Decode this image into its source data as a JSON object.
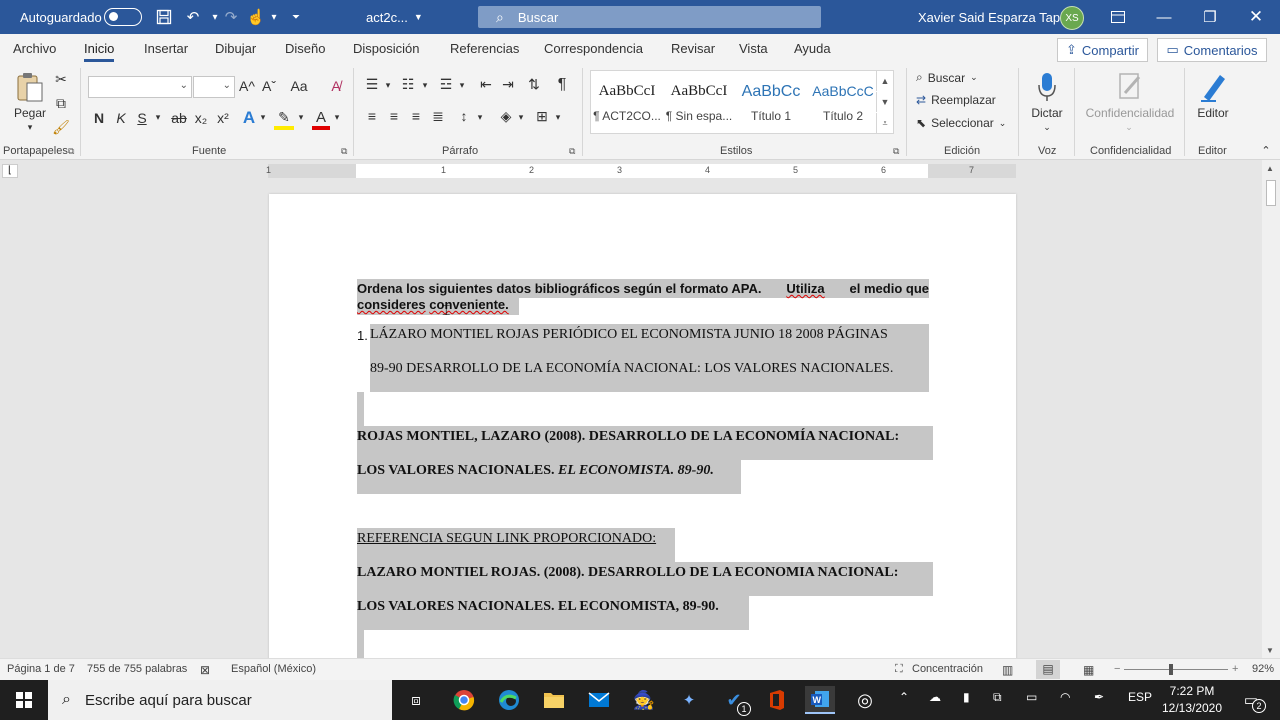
{
  "titlebar": {
    "autosave_label": "Autoguardado",
    "doc_name": "act2c...",
    "search_placeholder": "Buscar",
    "user_name": "Xavier Said Esparza Tapia",
    "user_initials": "XS"
  },
  "menu": {
    "tabs": [
      "Archivo",
      "Inicio",
      "Insertar",
      "Dibujar",
      "Diseño",
      "Disposición",
      "Referencias",
      "Correspondencia",
      "Revisar",
      "Vista",
      "Ayuda"
    ],
    "active": "Inicio",
    "share_label": "Compartir",
    "comments_label": "Comentarios"
  },
  "ribbon": {
    "paste_label": "Pegar",
    "groups": {
      "clipboard": "Portapapeles",
      "font": "Fuente",
      "paragraph": "Párrafo",
      "styles": "Estilos",
      "editing": "Edición",
      "voice": "Voz",
      "sensitivity": "Confidencialidad",
      "editor": "Editor"
    },
    "font_buttons": {
      "bold": "N",
      "italic": "K",
      "underline": "S",
      "strike": "ab",
      "subscript": "x₂",
      "superscript": "x²",
      "grow": "A^",
      "shrink": "Aˇ",
      "case": "Aa"
    },
    "styles": [
      {
        "sample": "AaBbCcI",
        "name": "¶ ACT2CO..."
      },
      {
        "sample": "AaBbCcI",
        "name": "¶ Sin espa..."
      },
      {
        "sample": "AaBbCc",
        "name": "Título 1"
      },
      {
        "sample": "AaBbCcC",
        "name": "Título 2"
      }
    ],
    "editing": {
      "find": "Buscar",
      "replace": "Reemplazar",
      "select": "Seleccionar"
    },
    "dictate_label": "Dictar",
    "sensitivity_label": "Confidencialidad",
    "editor_label": "Editor"
  },
  "ruler": {
    "numbers": [
      "1",
      "1",
      "2",
      "3",
      "4",
      "5",
      "6",
      "7"
    ]
  },
  "document": {
    "instruction_line1_a": "Ordena los siguientes datos bibliográficos según el formato APA.",
    "instruction_line1_b": "Utiliza",
    "instruction_line1_c": "el medio que",
    "instruction_line2_a": "consideres",
    "instruction_line2_b": "conveniente.",
    "list_number": "1.",
    "item_line1": "LÁZARO MONTIEL ROJAS PERIÓDICO EL ECONOMISTA JUNIO 18 2008 PÁGINAS",
    "item_line2": "89-90 DESARROLLO DE LA ECONOMÍA NACIONAL: LOS VALORES NACIONALES.",
    "answer_line1": "ROJAS MONTIEL, LAZARO (2008). DESARROLLO DE LA ECONOMÍA NACIONAL:",
    "answer_line2_a": "LOS VALORES NACIONALES.",
    "answer_line2_b": "EL ECONOMISTA. 89-90.",
    "ref_heading": "REFERENCIA SEGUN LINK PROPORCIONADO:",
    "ref_line1": "LAZARO MONTIEL ROJAS. (2008). DESARROLLO DE LA ECONOMIA NACIONAL:",
    "ref_line2": "LOS VALORES NACIONALES. EL ECONOMISTA, 89-90."
  },
  "statusbar": {
    "page": "Página 1 de 7",
    "words": "755 de 755 palabras",
    "language": "Español (México)",
    "focus": "Concentración",
    "zoom_minus": "−",
    "zoom_plus": "+",
    "zoom": "92%",
    "zoom_level": 0.92
  },
  "taskbar": {
    "search_placeholder": "Escribe aquí para buscar",
    "language": "ESP",
    "time": "7:22 PM",
    "date": "12/13/2020",
    "notifications": "2",
    "todo_badge": "1"
  },
  "colors": {
    "word_blue": "#2b579a",
    "selection": "#c6c6c6",
    "taskbar": "#1f1f1f"
  }
}
